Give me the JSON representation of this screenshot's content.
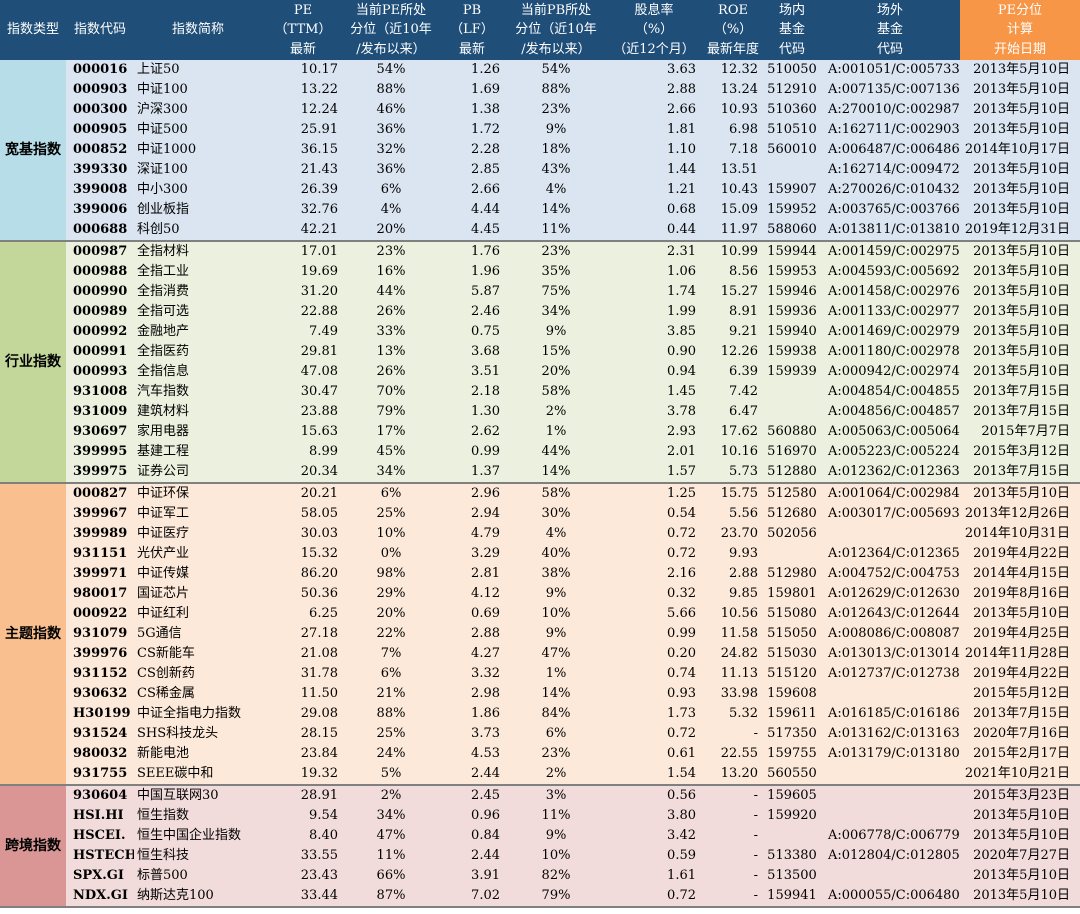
{
  "header": [
    "指数类型",
    "指数代码",
    "指数简称",
    "PE\n（TTM）\n最新",
    "当前PE所处\n分位（近10年\n/发布以来）",
    "PB\n（LF）\n最新",
    "当前PB所处\n分位（近10年\n/发布以来）",
    "股息率\n（%）\n（近12个月）",
    "ROE\n（%）\n最新年度",
    "场内\n基金\n代码",
    "场外\n基金\n代码",
    "PE分位\n计算\n开始日期"
  ],
  "colors": {
    "header_bg": "#1f4e79",
    "header_highlight": "#f79646"
  },
  "groups": [
    {
      "name": "宽基指数",
      "bg": "#dbe5f1",
      "cat_bg": "#b7dde8",
      "rows": [
        [
          "000016",
          "上证50",
          "10.17",
          "54%",
          "1.26",
          "54%",
          "3.63",
          "12.32",
          "510050",
          "A:001051/C:005733",
          "2013年5月10日"
        ],
        [
          "000903",
          "中证100",
          "13.22",
          "88%",
          "1.69",
          "88%",
          "2.88",
          "13.24",
          "512910",
          "A:007135/C:007136",
          "2013年5月10日"
        ],
        [
          "000300",
          "沪深300",
          "12.24",
          "46%",
          "1.38",
          "23%",
          "2.66",
          "10.93",
          "510360",
          "A:270010/C:002987",
          "2013年5月10日"
        ],
        [
          "000905",
          "中证500",
          "25.91",
          "36%",
          "1.72",
          "9%",
          "1.81",
          "6.98",
          "510510",
          "A:162711/C:002903",
          "2013年5月10日"
        ],
        [
          "000852",
          "中证1000",
          "36.15",
          "32%",
          "2.28",
          "18%",
          "1.10",
          "7.18",
          "560010",
          "A:006487/C:006486",
          "2014年10月17日"
        ],
        [
          "399330",
          "深证100",
          "21.43",
          "36%",
          "2.85",
          "43%",
          "1.44",
          "13.51",
          "",
          "A:162714/C:009472",
          "2013年5月10日"
        ],
        [
          "399008",
          "中小300",
          "26.39",
          "6%",
          "2.66",
          "4%",
          "1.21",
          "10.43",
          "159907",
          "A:270026/C:010432",
          "2013年5月10日"
        ],
        [
          "399006",
          "创业板指",
          "32.76",
          "4%",
          "4.44",
          "14%",
          "0.68",
          "15.09",
          "159952",
          "A:003765/C:003766",
          "2013年5月10日"
        ],
        [
          "000688",
          "科创50",
          "42.21",
          "20%",
          "4.45",
          "11%",
          "0.44",
          "11.97",
          "588060",
          "A:013811/C:013810",
          "2019年12月31日"
        ]
      ]
    },
    {
      "name": "行业指数",
      "bg": "#ebf1de",
      "cat_bg": "#c4d79b",
      "rows": [
        [
          "000987",
          "全指材料",
          "17.01",
          "23%",
          "1.76",
          "23%",
          "2.31",
          "10.99",
          "159944",
          "A:001459/C:002975",
          "2013年5月10日"
        ],
        [
          "000988",
          "全指工业",
          "19.69",
          "16%",
          "1.96",
          "35%",
          "1.06",
          "8.56",
          "159953",
          "A:004593/C:005692",
          "2013年5月10日"
        ],
        [
          "000990",
          "全指消费",
          "31.20",
          "44%",
          "5.87",
          "75%",
          "1.74",
          "15.27",
          "159946",
          "A:001458/C:002976",
          "2013年5月10日"
        ],
        [
          "000989",
          "全指可选",
          "22.88",
          "26%",
          "2.46",
          "34%",
          "1.99",
          "8.91",
          "159936",
          "A:001133/C:002977",
          "2013年5月10日"
        ],
        [
          "000992",
          "金融地产",
          "7.49",
          "33%",
          "0.75",
          "9%",
          "3.85",
          "9.21",
          "159940",
          "A:001469/C:002979",
          "2013年5月10日"
        ],
        [
          "000991",
          "全指医药",
          "29.81",
          "13%",
          "3.68",
          "15%",
          "0.90",
          "12.26",
          "159938",
          "A:001180/C:002978",
          "2013年5月10日"
        ],
        [
          "000993",
          "全指信息",
          "47.08",
          "26%",
          "3.51",
          "20%",
          "0.94",
          "6.39",
          "159939",
          "A:000942/C:002974",
          "2013年5月10日"
        ],
        [
          "931008",
          "汽车指数",
          "30.47",
          "70%",
          "2.18",
          "58%",
          "1.45",
          "7.42",
          "",
          "A:004854/C:004855",
          "2013年7月15日"
        ],
        [
          "931009",
          "建筑材料",
          "23.88",
          "79%",
          "1.30",
          "2%",
          "3.78",
          "6.47",
          "",
          "A:004856/C:004857",
          "2013年7月15日"
        ],
        [
          "930697",
          "家用电器",
          "15.63",
          "17%",
          "2.62",
          "1%",
          "2.93",
          "17.62",
          "560880",
          "A:005063/C:005064",
          "2015年7月7日"
        ],
        [
          "399995",
          "基建工程",
          "8.99",
          "45%",
          "0.99",
          "44%",
          "2.01",
          "10.16",
          "516970",
          "A:005223/C:005224",
          "2015年3月12日"
        ],
        [
          "399975",
          "证券公司",
          "20.34",
          "34%",
          "1.37",
          "14%",
          "1.57",
          "5.73",
          "512880",
          "A:012362/C:012363",
          "2013年7月15日"
        ]
      ]
    },
    {
      "name": "主题指数",
      "bg": "#fde9d9",
      "cat_bg": "#fabf8f",
      "rows": [
        [
          "000827",
          "中证环保",
          "20.21",
          "6%",
          "2.96",
          "58%",
          "1.25",
          "15.75",
          "512580",
          "A:001064/C:002984",
          "2013年5月10日"
        ],
        [
          "399967",
          "中证军工",
          "58.05",
          "25%",
          "2.94",
          "30%",
          "0.54",
          "5.56",
          "512680",
          "A:003017/C:005693",
          "2013年12月26日"
        ],
        [
          "399989",
          "中证医疗",
          "30.03",
          "10%",
          "4.79",
          "4%",
          "0.72",
          "23.70",
          "502056",
          "",
          "2014年10月31日"
        ],
        [
          "931151",
          "光伏产业",
          "15.32",
          "0%",
          "3.29",
          "40%",
          "0.72",
          "9.93",
          "",
          "A:012364/C:012365",
          "2019年4月22日"
        ],
        [
          "399971",
          "中证传媒",
          "86.20",
          "98%",
          "2.81",
          "38%",
          "2.16",
          "2.88",
          "512980",
          "A:004752/C:004753",
          "2014年4月15日"
        ],
        [
          "980017",
          "国证芯片",
          "50.36",
          "29%",
          "4.12",
          "9%",
          "0.32",
          "9.85",
          "159801",
          "A:012629/C:012630",
          "2019年8月16日"
        ],
        [
          "000922",
          "中证红利",
          "6.25",
          "20%",
          "0.69",
          "10%",
          "5.66",
          "10.56",
          "515080",
          "A:012643/C:012644",
          "2013年5月10日"
        ],
        [
          "931079",
          "5G通信",
          "27.18",
          "22%",
          "2.88",
          "9%",
          "0.99",
          "11.58",
          "515050",
          "A:008086/C:008087",
          "2019年4月25日"
        ],
        [
          "399976",
          "CS新能车",
          "21.08",
          "7%",
          "4.27",
          "47%",
          "0.20",
          "24.82",
          "515030",
          "A:013013/C:013014",
          "2014年11月28日"
        ],
        [
          "931152",
          "CS创新药",
          "31.78",
          "6%",
          "3.32",
          "1%",
          "0.74",
          "11.13",
          "515120",
          "A:012737/C:012738",
          "2019年4月22日"
        ],
        [
          "930632",
          "CS稀金属",
          "11.50",
          "21%",
          "2.98",
          "14%",
          "0.93",
          "33.98",
          "159608",
          "",
          "2015年5月12日"
        ],
        [
          "H30199",
          "中证全指电力指数",
          "29.08",
          "88%",
          "1.86",
          "84%",
          "1.73",
          "5.32",
          "159611",
          "A:016185/C:016186",
          "2013年7月15日"
        ],
        [
          "931524",
          "SHS科技龙头",
          "28.15",
          "25%",
          "3.73",
          "6%",
          "0.72",
          "-",
          "517350",
          "A:013162/C:013163",
          "2020年7月16日"
        ],
        [
          "980032",
          "新能电池",
          "23.84",
          "24%",
          "4.53",
          "23%",
          "0.61",
          "22.55",
          "159755",
          "A:013179/C:013180",
          "2015年2月17日"
        ],
        [
          "931755",
          "SEEE碳中和",
          "19.32",
          "5%",
          "2.44",
          "2%",
          "1.54",
          "13.20",
          "560550",
          "",
          "2021年10月21日"
        ]
      ]
    },
    {
      "name": "跨境指数",
      "bg": "#f2dcdb",
      "cat_bg": "#da9694",
      "rows": [
        [
          "930604",
          "中国互联网30",
          "28.91",
          "2%",
          "2.45",
          "3%",
          "0.56",
          "-",
          "159605",
          "",
          "2015年3月23日"
        ],
        [
          "HSI.HI",
          "恒生指数",
          "9.54",
          "34%",
          "0.96",
          "11%",
          "3.80",
          "-",
          "159920",
          "",
          "2013年5月10日"
        ],
        [
          "HSCEI.",
          "恒生中国企业指数",
          "8.40",
          "47%",
          "0.84",
          "9%",
          "3.42",
          "-",
          "",
          "A:006778/C:006779",
          "2013年5月10日"
        ],
        [
          "HSTECH",
          "恒生科技",
          "33.55",
          "11%",
          "2.44",
          "10%",
          "0.59",
          "-",
          "513380",
          "A:012804/C:012805",
          "2020年7月27日"
        ],
        [
          "SPX.GI",
          "标普500",
          "23.43",
          "66%",
          "3.91",
          "82%",
          "1.61",
          "-",
          "513500",
          "",
          "2013年5月10日"
        ],
        [
          "NDX.GI",
          "纳斯达克100",
          "33.44",
          "87%",
          "7.02",
          "79%",
          "0.72",
          "-",
          "159941",
          "A:000055/C:006480",
          "2013年5月10日"
        ]
      ]
    }
  ]
}
